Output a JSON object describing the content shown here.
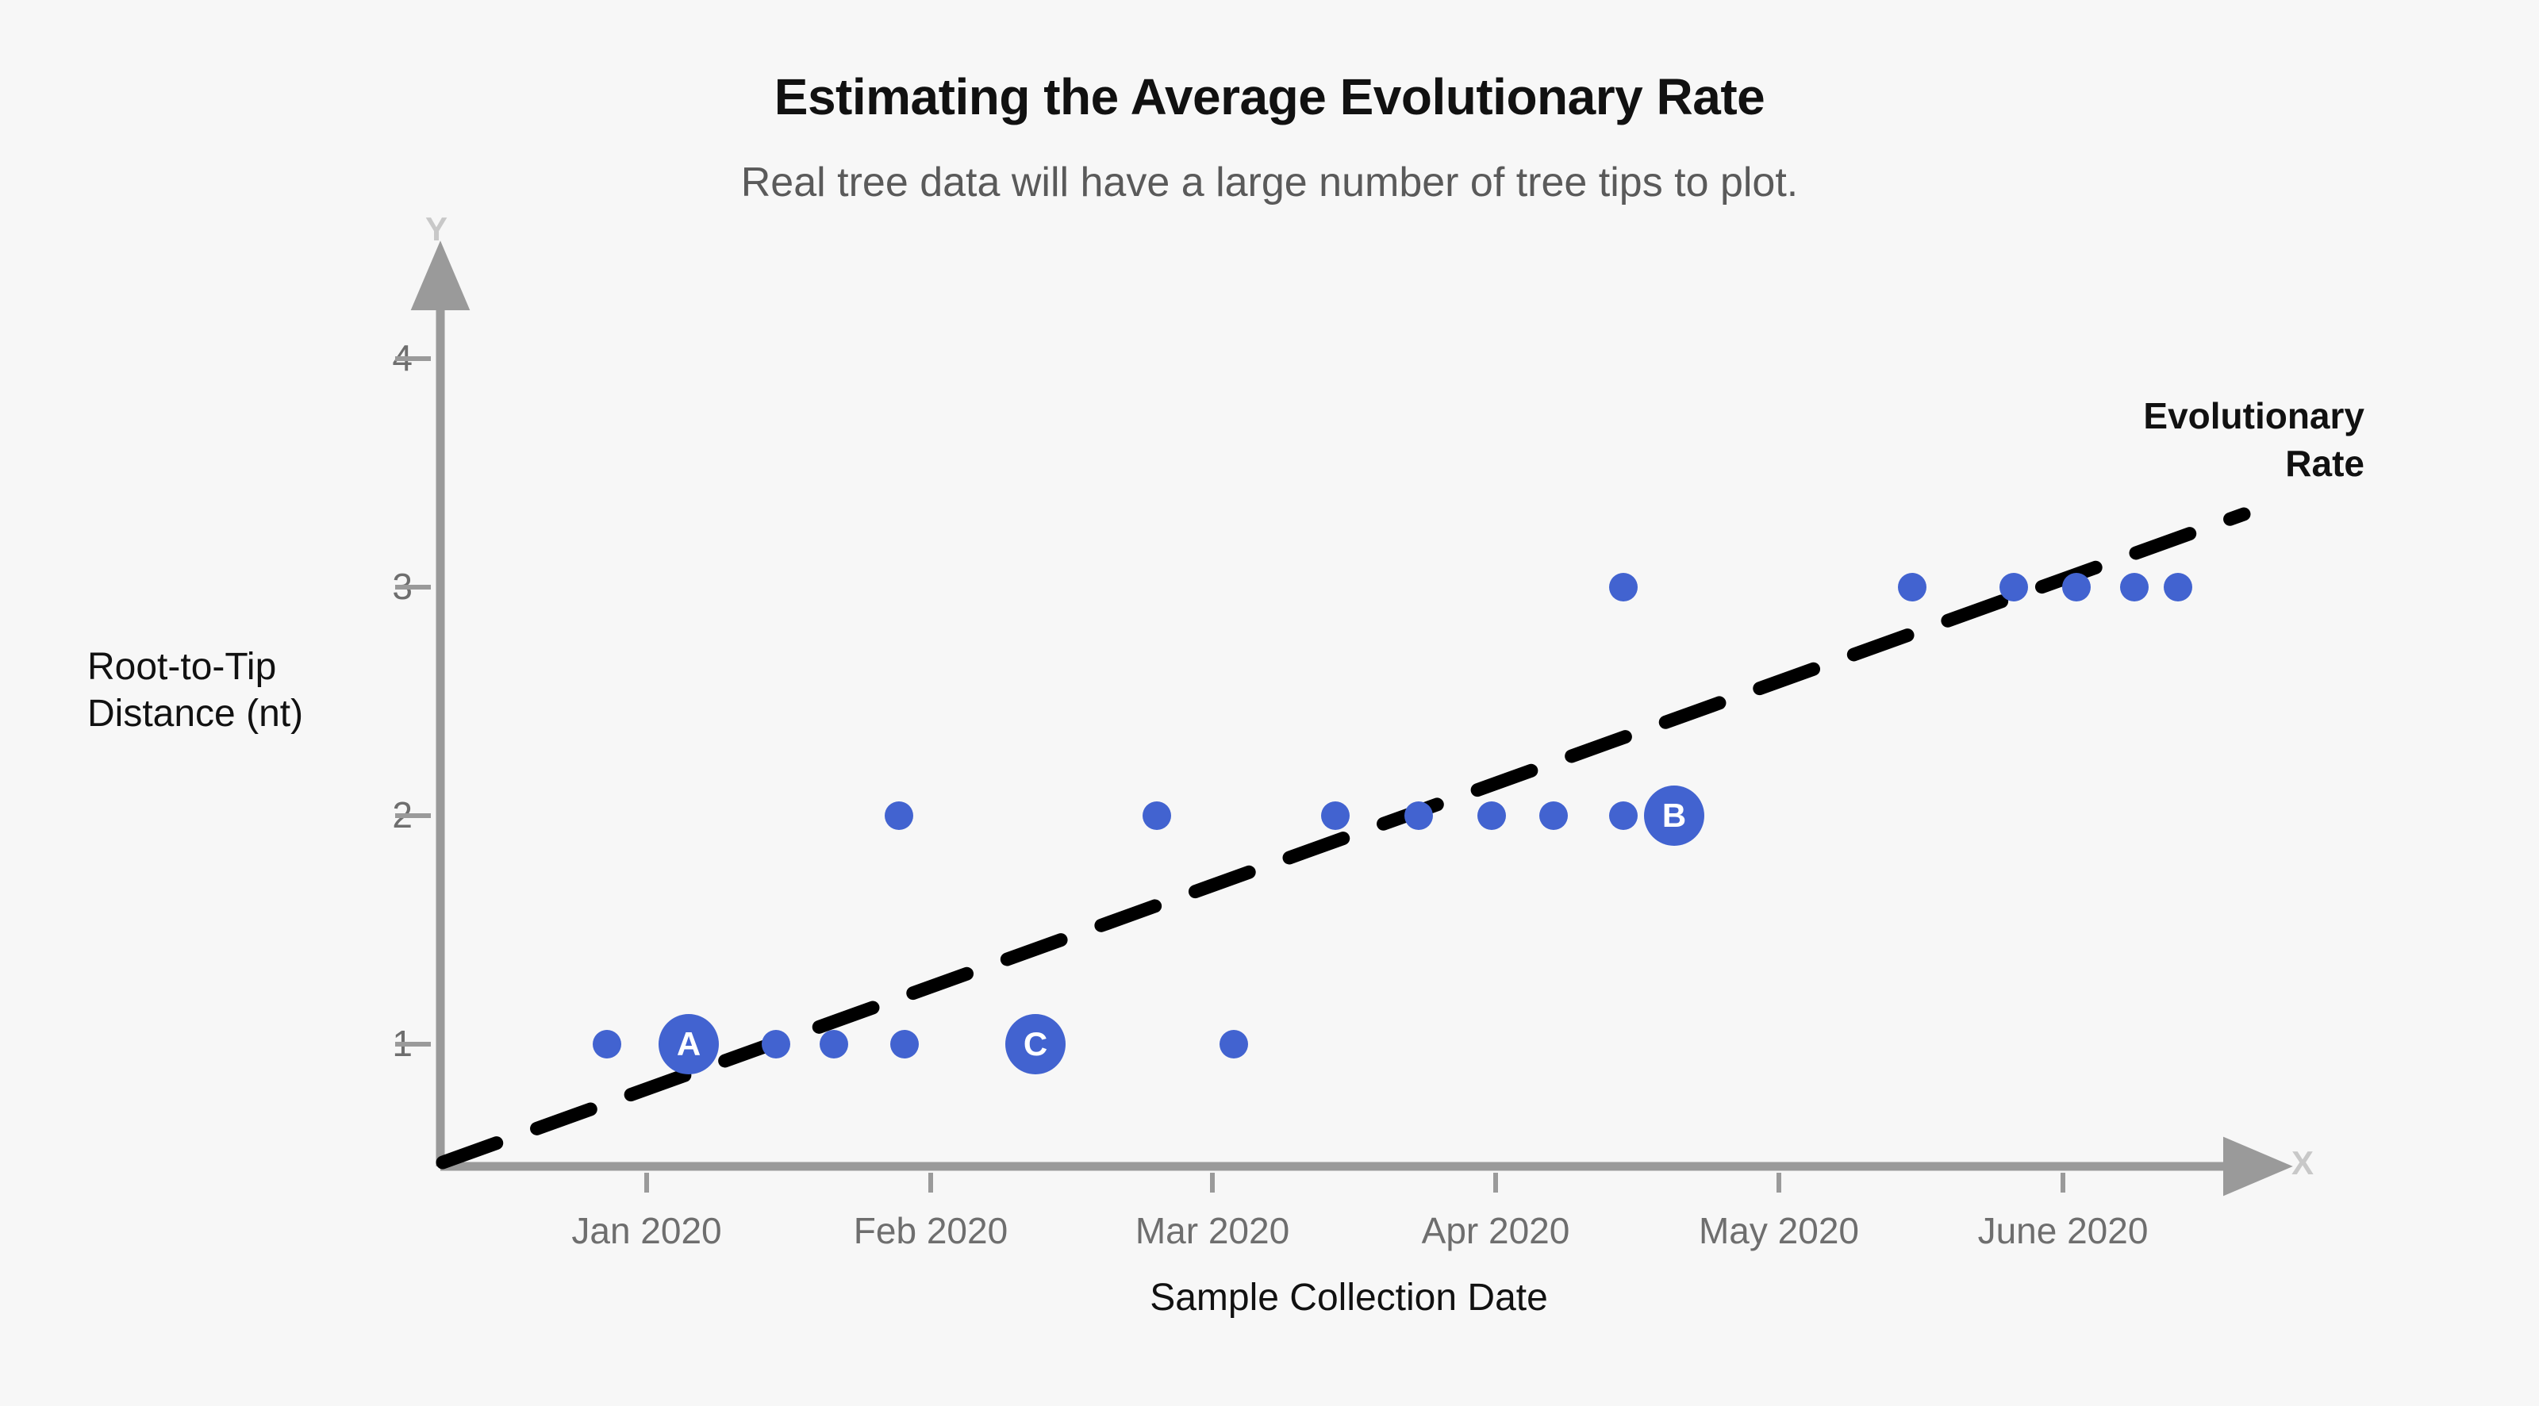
{
  "chart_data": {
    "type": "scatter",
    "title": "Estimating the Average Evolutionary Rate",
    "subtitle": "Real tree data will have a large number of tree tips to plot.",
    "xlabel": "Sample Collection Date",
    "ylabel_line1": "Root-to-Tip",
    "ylabel_line2": "Distance (nt)",
    "x_axis_letter": "X",
    "y_axis_letter": "Y",
    "grid": false,
    "legend_position": "none",
    "xtick_labels": [
      "Jan 2020",
      "Feb 2020",
      "Mar 2020",
      "Apr 2020",
      "May 2020",
      "June 2020"
    ],
    "ytick_labels": [
      "1",
      "2",
      "3",
      "4"
    ],
    "ylim": [
      0,
      4.5
    ],
    "annotations": [
      {
        "text_line1": "Evolutionary",
        "text_line2": "Rate",
        "target": "trend-line"
      }
    ],
    "trend_line": {
      "style": "dashed",
      "color": "#000000",
      "label": "Evolutionary Rate",
      "x_start_label": "origin",
      "x_end_label": "late June 2020",
      "y_start": 0.36,
      "y_end": 3.33
    },
    "point_color": "#4263d0",
    "points": [
      {
        "x_label": "2019-12-24",
        "y": 1,
        "label": null,
        "size": "small"
      },
      {
        "x_label": "2020-01-04",
        "y": 1,
        "label": "A",
        "size": "large"
      },
      {
        "x_label": "2020-01-15",
        "y": 1,
        "label": null,
        "size": "small"
      },
      {
        "x_label": "2020-01-22",
        "y": 1,
        "label": null,
        "size": "small"
      },
      {
        "x_label": "2020-01-30",
        "y": 1,
        "label": null,
        "size": "small"
      },
      {
        "x_label": "2020-02-15",
        "y": 1,
        "label": "C",
        "size": "large"
      },
      {
        "x_label": "2020-03-08",
        "y": 1,
        "label": null,
        "size": "small"
      },
      {
        "x_label": "2020-01-30",
        "y": 2,
        "label": null,
        "size": "small"
      },
      {
        "x_label": "2020-02-28",
        "y": 2,
        "label": null,
        "size": "small"
      },
      {
        "x_label": "2020-03-18",
        "y": 2,
        "label": null,
        "size": "small"
      },
      {
        "x_label": "2020-03-27",
        "y": 2,
        "label": null,
        "size": "small"
      },
      {
        "x_label": "2020-04-04",
        "y": 2,
        "label": null,
        "size": "small"
      },
      {
        "x_label": "2020-04-11",
        "y": 2,
        "label": null,
        "size": "small"
      },
      {
        "x_label": "2020-04-18",
        "y": 2,
        "label": null,
        "size": "small"
      },
      {
        "x_label": "2020-04-26",
        "y": 2,
        "label": "B",
        "size": "large"
      },
      {
        "x_label": "2020-04-21",
        "y": 3,
        "label": null,
        "size": "small"
      },
      {
        "x_label": "2020-05-26",
        "y": 3,
        "label": null,
        "size": "small"
      },
      {
        "x_label": "2020-06-07",
        "y": 3,
        "label": null,
        "size": "small"
      },
      {
        "x_label": "2020-06-14",
        "y": 3,
        "label": null,
        "size": "small"
      },
      {
        "x_label": "2020-06-20",
        "y": 3,
        "label": null,
        "size": "small"
      },
      {
        "x_label": "2020-06-25",
        "y": 3,
        "label": null,
        "size": "small"
      }
    ]
  },
  "colors": {
    "background": "#f7f7f7",
    "point": "#4263d0",
    "axis": "#9a9a9a",
    "axis_letter": "#c8c8c8",
    "tick_text": "#6e6e6e",
    "title_text": "#111111",
    "subtitle_text": "#5a5a5a",
    "trend_line": "#000000"
  }
}
